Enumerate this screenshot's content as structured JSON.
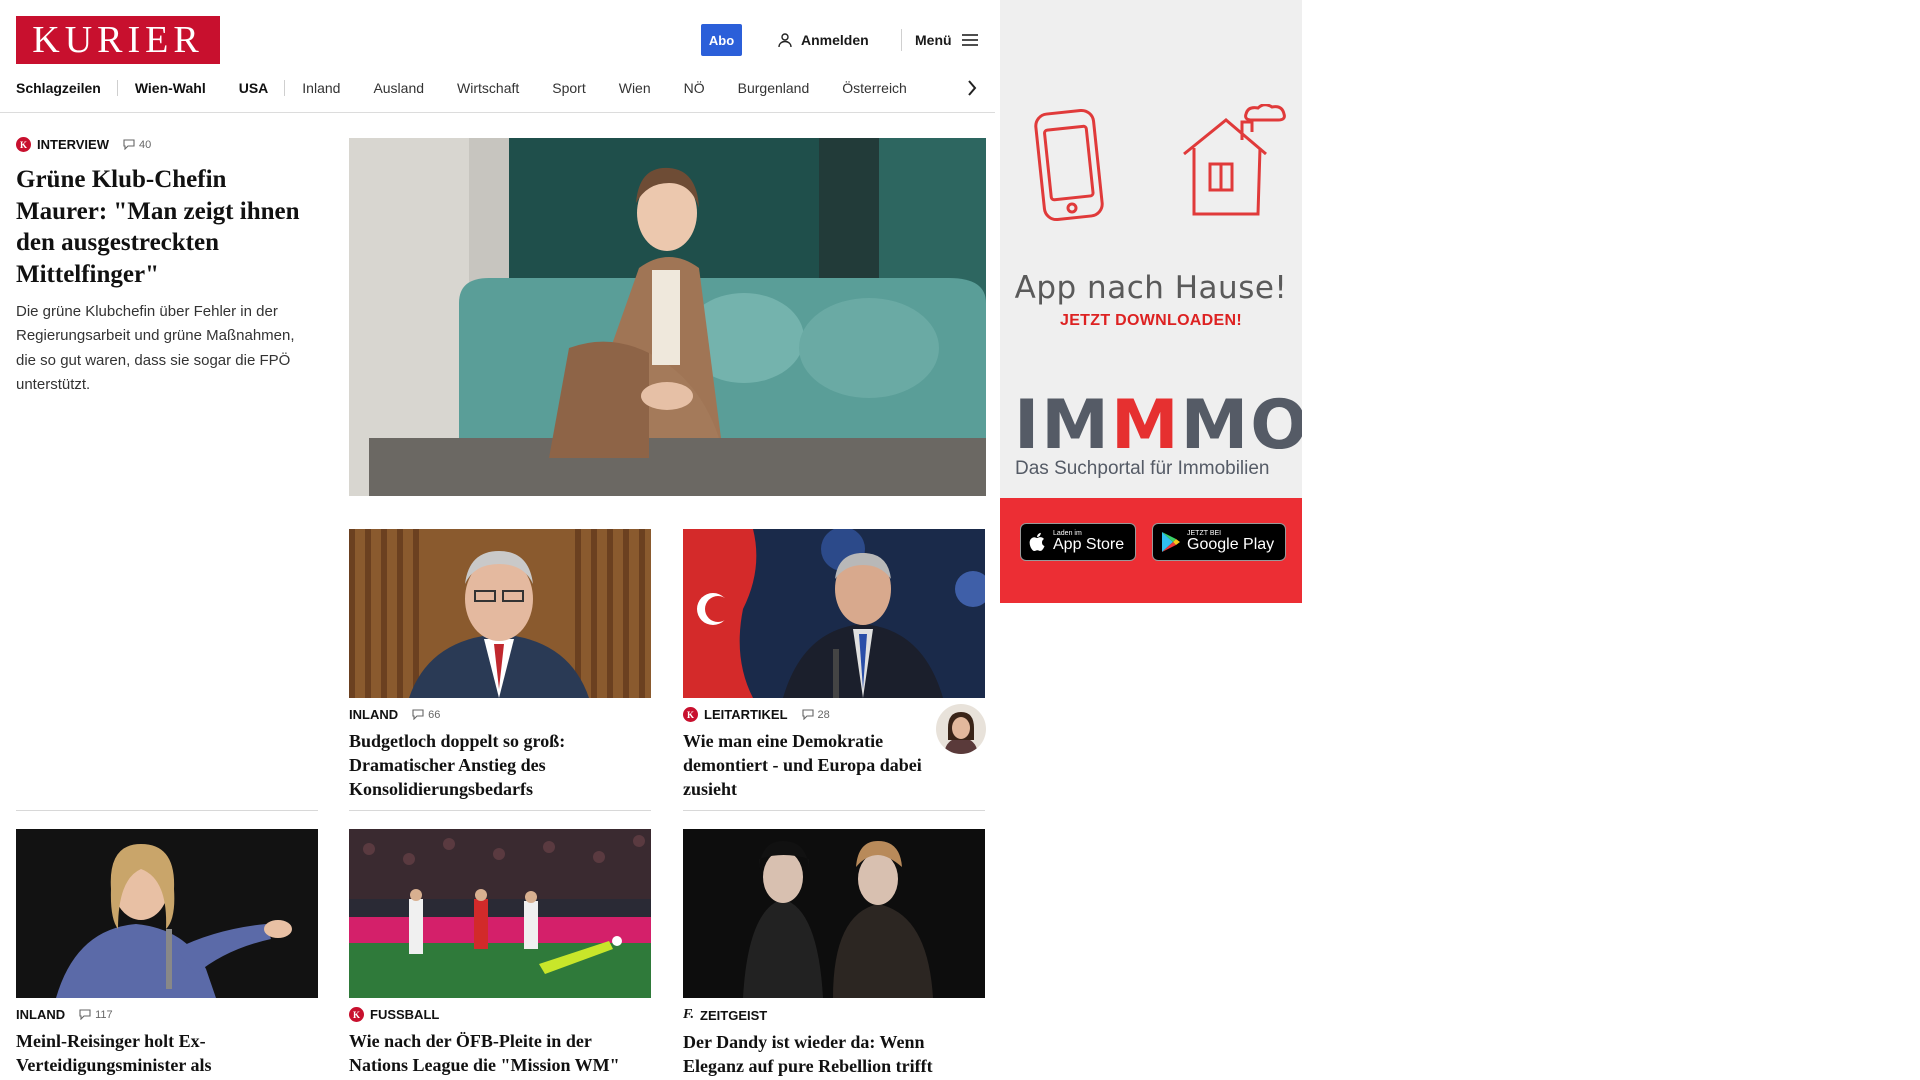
{
  "header": {
    "logo": "KURIER",
    "abo_label": "Abo",
    "login_label": "Anmelden",
    "menu_label": "Menü"
  },
  "nav": {
    "items": [
      "Schlagzeilen",
      "Wien-Wahl",
      "USA",
      "Inland",
      "Ausland",
      "Wirtschaft",
      "Sport",
      "Wien",
      "NÖ",
      "Burgenland",
      "Österreich"
    ]
  },
  "lead": {
    "kicker": "INTERVIEW",
    "comments": "40",
    "headline": "Grüne Klub-Chefin Maurer: \"Man zeigt ihnen den ausgestreckten Mittelfinger\"",
    "teaser": "Die grüne Klubchefin über Fehler in der Regierungsarbeit und grüne Maßnahmen, die so gut waren, dass sie sogar die FPÖ unterstützt."
  },
  "articles": [
    {
      "kicker": "INLAND",
      "comments": "66",
      "headline": "Budgetloch doppelt so groß: Dramatischer Anstieg des Konsolidierungsbedarfs"
    },
    {
      "kicker": "LEITARTIKEL",
      "comments": "28",
      "headline": "Wie man eine Demokratie demontiert - und Europa dabei zusieht"
    },
    {
      "kicker": "INLAND",
      "comments": "117",
      "headline": "Meinl-Reisinger holt Ex-Verteidigungsminister als sicherheitspolitischen Berater"
    },
    {
      "kicker": "FUSSBALL",
      "comments": "",
      "headline": "Wie nach der ÖFB-Pleite in der Nations League die \"Mission WM\" gelingen kann"
    },
    {
      "kicker": "ZEITGEIST",
      "comments": "",
      "headline": "Der Dandy ist wieder da: Wenn Eleganz auf pure Rebellion trifft"
    }
  ],
  "ad": {
    "title": "App nach Hause!",
    "cta": "JETZT DOWNLOADEN!",
    "brand_part1": "IM",
    "brand_red": "M",
    "brand_part2": "MO",
    "brand_sub": "Das Suchportal für Immobilien",
    "appstore_small": "Laden im",
    "appstore_big": "App Store",
    "gplay_small": "JETZT BEI",
    "gplay_big": "Google Play"
  },
  "colors": {
    "brand_red": "#c8102e",
    "abo_blue": "#2b5fd9",
    "ad_red": "#ec2e34"
  }
}
